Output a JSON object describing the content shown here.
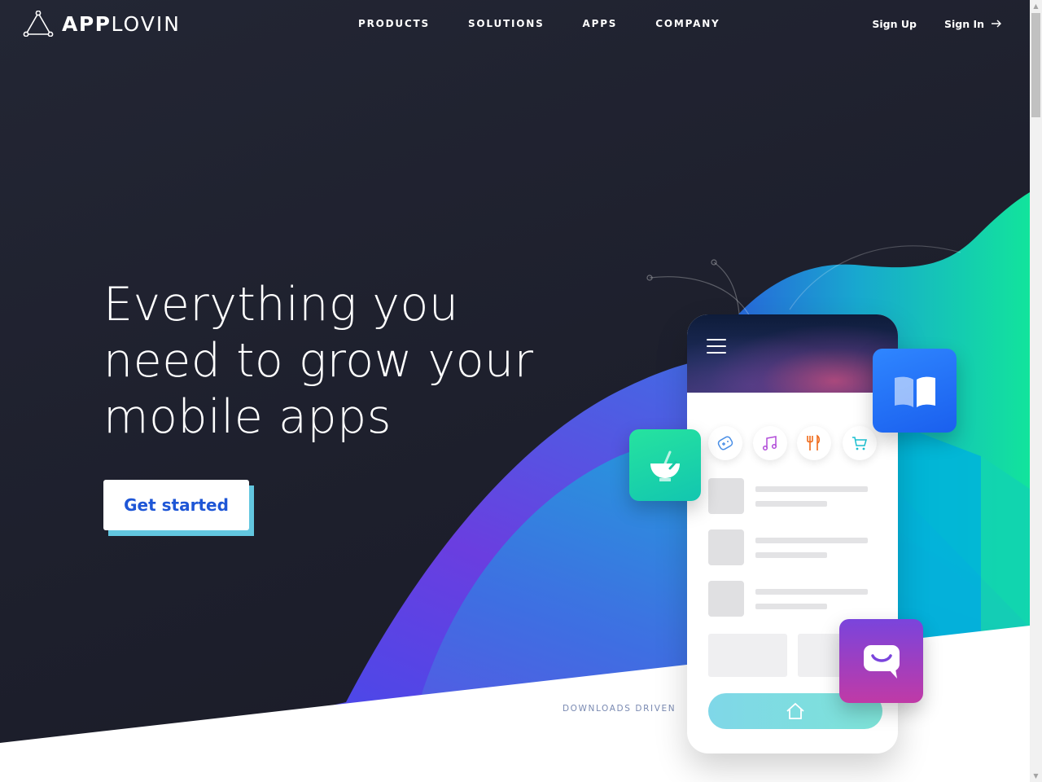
{
  "brand": {
    "bold": "APP",
    "light": "LOVIN"
  },
  "nav": {
    "items": [
      {
        "label": "PRODUCTS"
      },
      {
        "label": "SOLUTIONS"
      },
      {
        "label": "APPS"
      },
      {
        "label": "COMPANY"
      }
    ]
  },
  "auth": {
    "sign_up": "Sign Up",
    "sign_in": "Sign In"
  },
  "hero": {
    "headline_lines": [
      "Everything you",
      "need to grow your",
      "mobile apps"
    ],
    "cta": "Get started",
    "downloads_label": "DOWNLOADS DRIVEN"
  },
  "phone": {
    "menu_icon": "hamburger-menu-icon",
    "categories": [
      "gamepad-icon",
      "music-note-icon",
      "fork-knife-icon",
      "shopping-cart-icon"
    ],
    "home_icon": "home-icon"
  },
  "tiles": [
    "bowl-icon",
    "open-book-icon",
    "chat-smile-icon"
  ],
  "colors": {
    "background": "#1e2130",
    "cta_text": "#1e56d6",
    "cta_shadow": "#62c6df",
    "accent_teal": "#12d9a0",
    "accent_purple": "#6a3ee0",
    "accent_blue": "#2f6bff"
  }
}
